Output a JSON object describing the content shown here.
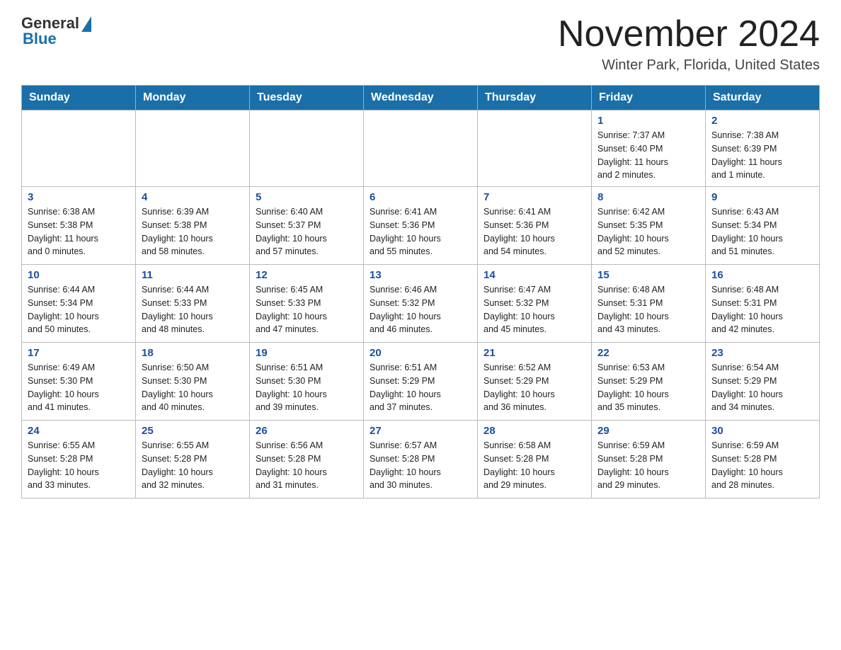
{
  "header": {
    "logo_general": "General",
    "logo_blue": "Blue",
    "month_title": "November 2024",
    "location": "Winter Park, Florida, United States"
  },
  "weekdays": [
    "Sunday",
    "Monday",
    "Tuesday",
    "Wednesday",
    "Thursday",
    "Friday",
    "Saturday"
  ],
  "weeks": [
    [
      {
        "day": "",
        "info": ""
      },
      {
        "day": "",
        "info": ""
      },
      {
        "day": "",
        "info": ""
      },
      {
        "day": "",
        "info": ""
      },
      {
        "day": "",
        "info": ""
      },
      {
        "day": "1",
        "info": "Sunrise: 7:37 AM\nSunset: 6:40 PM\nDaylight: 11 hours\nand 2 minutes."
      },
      {
        "day": "2",
        "info": "Sunrise: 7:38 AM\nSunset: 6:39 PM\nDaylight: 11 hours\nand 1 minute."
      }
    ],
    [
      {
        "day": "3",
        "info": "Sunrise: 6:38 AM\nSunset: 5:38 PM\nDaylight: 11 hours\nand 0 minutes."
      },
      {
        "day": "4",
        "info": "Sunrise: 6:39 AM\nSunset: 5:38 PM\nDaylight: 10 hours\nand 58 minutes."
      },
      {
        "day": "5",
        "info": "Sunrise: 6:40 AM\nSunset: 5:37 PM\nDaylight: 10 hours\nand 57 minutes."
      },
      {
        "day": "6",
        "info": "Sunrise: 6:41 AM\nSunset: 5:36 PM\nDaylight: 10 hours\nand 55 minutes."
      },
      {
        "day": "7",
        "info": "Sunrise: 6:41 AM\nSunset: 5:36 PM\nDaylight: 10 hours\nand 54 minutes."
      },
      {
        "day": "8",
        "info": "Sunrise: 6:42 AM\nSunset: 5:35 PM\nDaylight: 10 hours\nand 52 minutes."
      },
      {
        "day": "9",
        "info": "Sunrise: 6:43 AM\nSunset: 5:34 PM\nDaylight: 10 hours\nand 51 minutes."
      }
    ],
    [
      {
        "day": "10",
        "info": "Sunrise: 6:44 AM\nSunset: 5:34 PM\nDaylight: 10 hours\nand 50 minutes."
      },
      {
        "day": "11",
        "info": "Sunrise: 6:44 AM\nSunset: 5:33 PM\nDaylight: 10 hours\nand 48 minutes."
      },
      {
        "day": "12",
        "info": "Sunrise: 6:45 AM\nSunset: 5:33 PM\nDaylight: 10 hours\nand 47 minutes."
      },
      {
        "day": "13",
        "info": "Sunrise: 6:46 AM\nSunset: 5:32 PM\nDaylight: 10 hours\nand 46 minutes."
      },
      {
        "day": "14",
        "info": "Sunrise: 6:47 AM\nSunset: 5:32 PM\nDaylight: 10 hours\nand 45 minutes."
      },
      {
        "day": "15",
        "info": "Sunrise: 6:48 AM\nSunset: 5:31 PM\nDaylight: 10 hours\nand 43 minutes."
      },
      {
        "day": "16",
        "info": "Sunrise: 6:48 AM\nSunset: 5:31 PM\nDaylight: 10 hours\nand 42 minutes."
      }
    ],
    [
      {
        "day": "17",
        "info": "Sunrise: 6:49 AM\nSunset: 5:30 PM\nDaylight: 10 hours\nand 41 minutes."
      },
      {
        "day": "18",
        "info": "Sunrise: 6:50 AM\nSunset: 5:30 PM\nDaylight: 10 hours\nand 40 minutes."
      },
      {
        "day": "19",
        "info": "Sunrise: 6:51 AM\nSunset: 5:30 PM\nDaylight: 10 hours\nand 39 minutes."
      },
      {
        "day": "20",
        "info": "Sunrise: 6:51 AM\nSunset: 5:29 PM\nDaylight: 10 hours\nand 37 minutes."
      },
      {
        "day": "21",
        "info": "Sunrise: 6:52 AM\nSunset: 5:29 PM\nDaylight: 10 hours\nand 36 minutes."
      },
      {
        "day": "22",
        "info": "Sunrise: 6:53 AM\nSunset: 5:29 PM\nDaylight: 10 hours\nand 35 minutes."
      },
      {
        "day": "23",
        "info": "Sunrise: 6:54 AM\nSunset: 5:29 PM\nDaylight: 10 hours\nand 34 minutes."
      }
    ],
    [
      {
        "day": "24",
        "info": "Sunrise: 6:55 AM\nSunset: 5:28 PM\nDaylight: 10 hours\nand 33 minutes."
      },
      {
        "day": "25",
        "info": "Sunrise: 6:55 AM\nSunset: 5:28 PM\nDaylight: 10 hours\nand 32 minutes."
      },
      {
        "day": "26",
        "info": "Sunrise: 6:56 AM\nSunset: 5:28 PM\nDaylight: 10 hours\nand 31 minutes."
      },
      {
        "day": "27",
        "info": "Sunrise: 6:57 AM\nSunset: 5:28 PM\nDaylight: 10 hours\nand 30 minutes."
      },
      {
        "day": "28",
        "info": "Sunrise: 6:58 AM\nSunset: 5:28 PM\nDaylight: 10 hours\nand 29 minutes."
      },
      {
        "day": "29",
        "info": "Sunrise: 6:59 AM\nSunset: 5:28 PM\nDaylight: 10 hours\nand 29 minutes."
      },
      {
        "day": "30",
        "info": "Sunrise: 6:59 AM\nSunset: 5:28 PM\nDaylight: 10 hours\nand 28 minutes."
      }
    ]
  ]
}
